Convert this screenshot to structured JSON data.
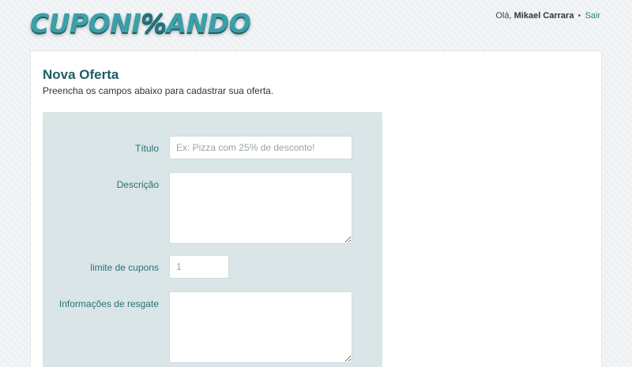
{
  "header": {
    "logo_left": "CUPONI",
    "logo_mark": "%",
    "logo_right": "ANDO",
    "greeting": "Olá,",
    "user_name": "Mikael Carrara",
    "separator": "•",
    "logout_label": "Sair"
  },
  "page": {
    "title": "Nova Oferta",
    "subtitle": "Preencha os campos abaixo para cadastrar sua oferta."
  },
  "form": {
    "title": {
      "label": "Título",
      "value": "",
      "placeholder": "Ex: Pizza com 25% de desconto!"
    },
    "description": {
      "label": "Descrição",
      "value": ""
    },
    "coupon_limit": {
      "label": "limite de cupons",
      "value": "",
      "placeholder": "1"
    },
    "redeem_info": {
      "label": "Informações de resgate",
      "value": ""
    }
  },
  "colors": {
    "brand": "#1d5e66",
    "logo": "#3aa0a9",
    "panel": "#d9e5e6",
    "link": "#2a7d86"
  }
}
